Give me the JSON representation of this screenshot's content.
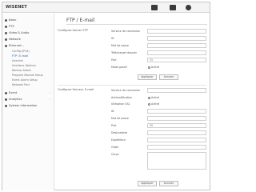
{
  "app": {
    "brand": "WISENET"
  },
  "topbar": {
    "icons": [
      "monitor-icon",
      "video-icon",
      "settings-icon"
    ]
  },
  "sidebar": {
    "items": [
      {
        "label": "Basic"
      },
      {
        "label": "PTZ"
      },
      {
        "label": "Video & Audio"
      },
      {
        "label": "Network"
      },
      {
        "label": "Ethernet..."
      }
    ],
    "subitems": [
      {
        "label": "Config (IPv4)"
      },
      {
        "label": "FTP / E-mail",
        "active": true
      },
      {
        "label": "Interlink"
      },
      {
        "label": "Interface (Notice)"
      },
      {
        "label": "Backup Admin"
      },
      {
        "label": "Program Module Setup"
      },
      {
        "label": "Event Alarm Setup"
      },
      {
        "label": "Network Port"
      }
    ],
    "lower_items": [
      {
        "label": "Event"
      },
      {
        "label": "Analytics"
      },
      {
        "label": "System Information"
      }
    ]
  },
  "main": {
    "title": "FTP / E-mail",
    "ftp": {
      "section_label": "Configure Server FTP",
      "rows": [
        {
          "label": "Serveur de connexion",
          "value": ""
        },
        {
          "label": "ID",
          "value": ""
        },
        {
          "label": "Mot de passe",
          "value": ""
        },
        {
          "label": "Télécharger dossier",
          "value": ""
        },
        {
          "label": "Port",
          "value": "21"
        },
        {
          "label": "Mode passif",
          "value": "Activé"
        }
      ],
      "buttons": {
        "apply": "Appliquer",
        "cancel": "Annuler"
      }
    },
    "email": {
      "section_label": "Configure Serveur E-mail",
      "rows": [
        {
          "label": "Serveur de connexion",
          "value": ""
        },
        {
          "label": "Authentification",
          "value": "Activé"
        },
        {
          "label": "Utilisation SSL",
          "value": "Activé"
        },
        {
          "label": "ID",
          "value": ""
        },
        {
          "label": "Mot de passe",
          "value": ""
        },
        {
          "label": "Port",
          "value": "25"
        },
        {
          "label": "Destinataire",
          "value": ""
        },
        {
          "label": "Expéditeur",
          "value": ""
        },
        {
          "label": "Objet",
          "value": ""
        },
        {
          "label": "Corps",
          "value": ""
        }
      ],
      "buttons": {
        "apply": "Appliquer",
        "cancel": "Annuler"
      }
    }
  }
}
